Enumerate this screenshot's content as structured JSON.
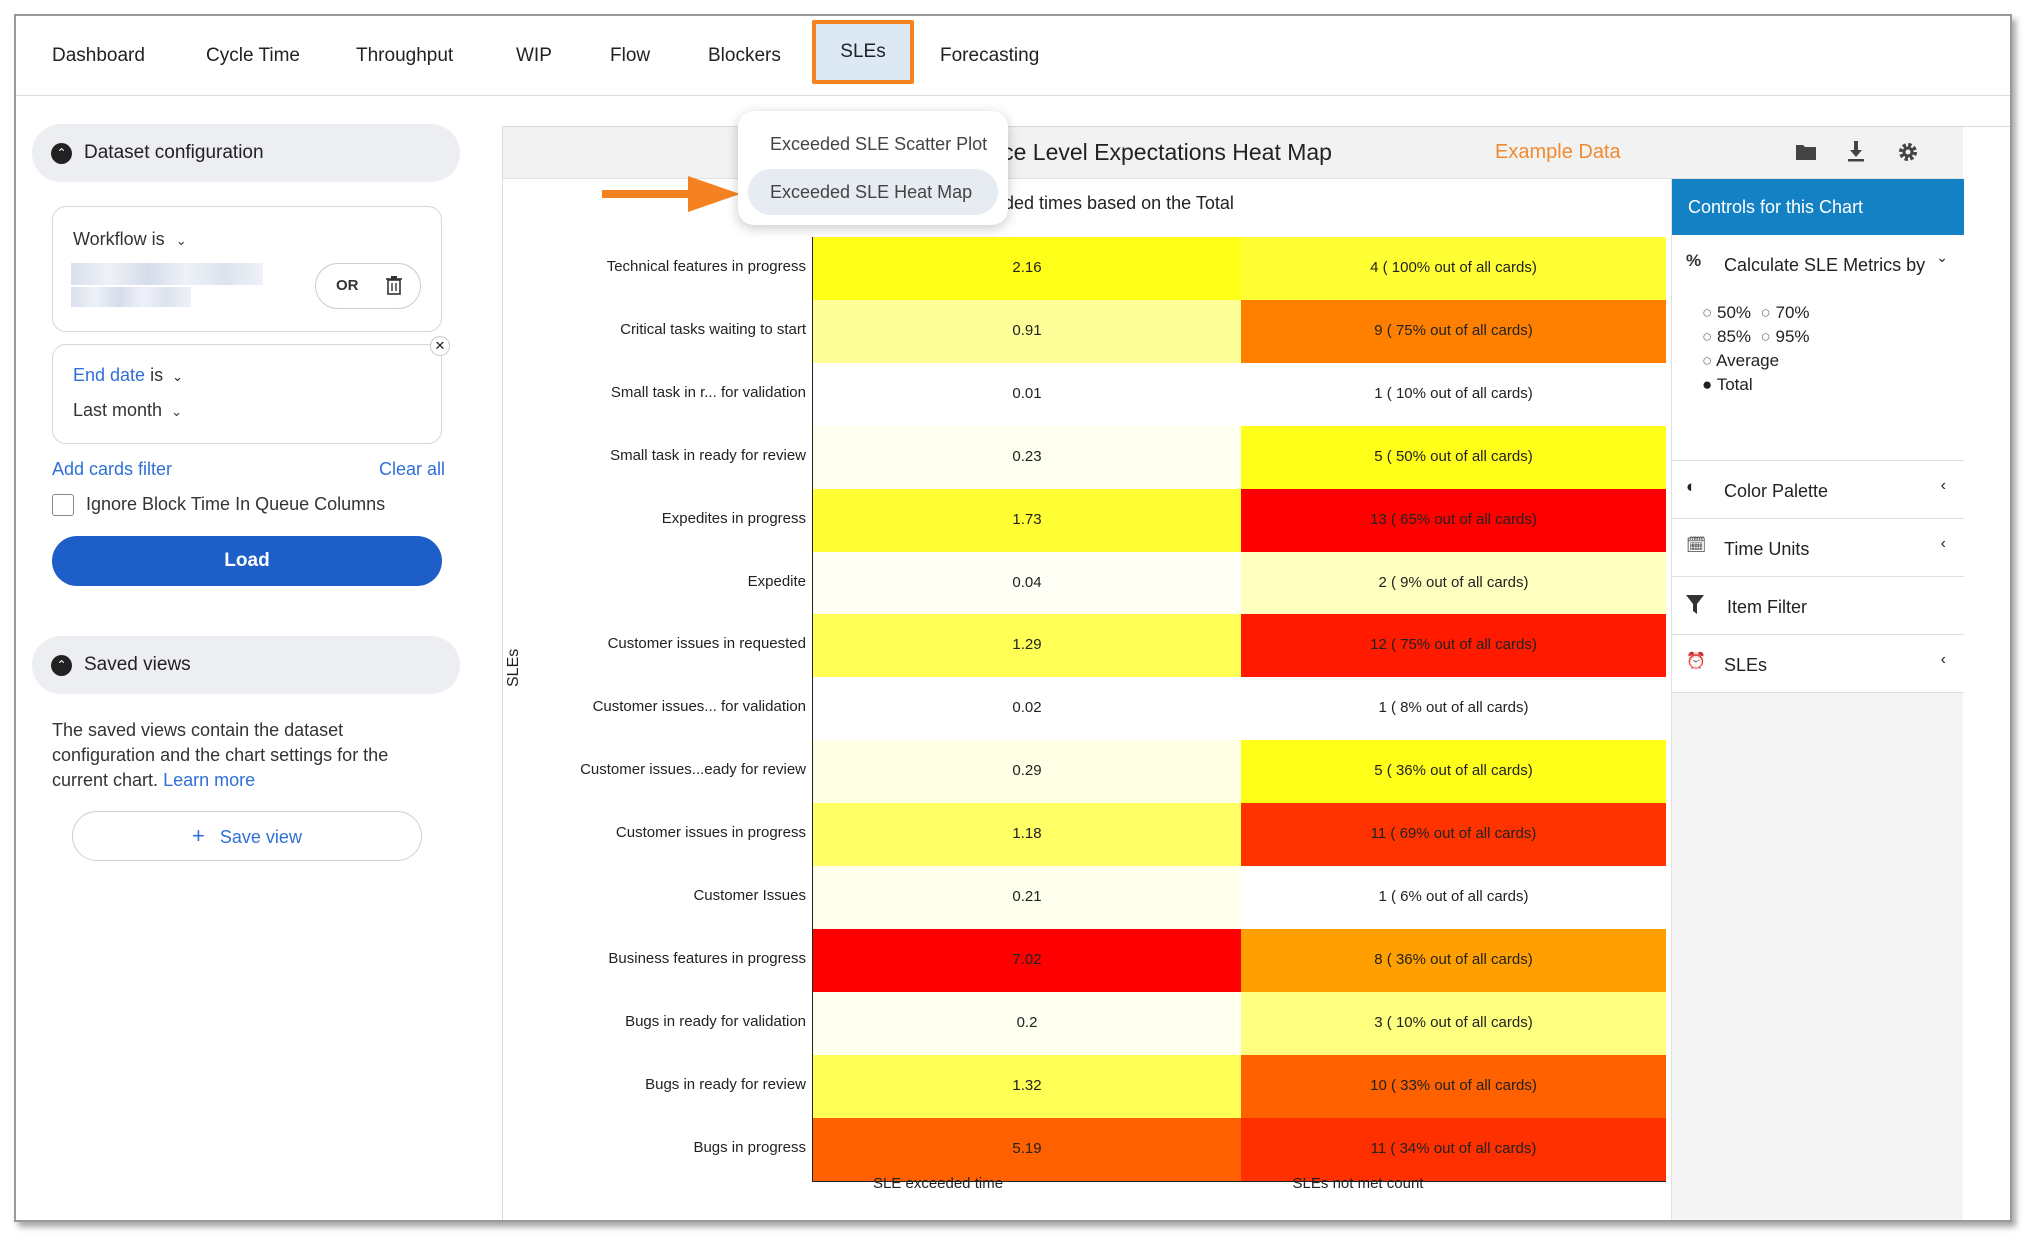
{
  "nav": {
    "tabs": [
      "Dashboard",
      "Cycle Time",
      "Throughput",
      "WIP",
      "Flow",
      "Blockers",
      "SLEs",
      "Forecasting"
    ],
    "active": "SLEs"
  },
  "dropdown": {
    "items": [
      "Exceeded SLE Scatter Plot",
      "Exceeded SLE Heat Map"
    ]
  },
  "dataset": {
    "title": "Dataset configuration",
    "workflow_label": "Workflow is",
    "or_label": "OR",
    "end_date_label": "End date",
    "end_date_is": "is",
    "end_date_value": "Last month",
    "add_filter": "Add cards filter",
    "clear_all": "Clear all",
    "ignore_block": "Ignore Block Time In Queue Columns",
    "load": "Load"
  },
  "saved": {
    "title": "Saved views",
    "desc": "The saved views contain the dataset configuration and the chart settings for the current chart.",
    "learn_more": "Learn more",
    "save_view": "Save view"
  },
  "chart_header": {
    "title": "ice Level Expectations Heat Map",
    "example": "Example Data",
    "subtitle": "ceeded times based on the Total"
  },
  "controls": {
    "title": "Controls for this Chart",
    "calc_label": "Calculate SLE Metrics by",
    "options": [
      "50%",
      "70%",
      "85%",
      "95%",
      "Average",
      "Total"
    ],
    "selected": "Total",
    "color_palette": "Color Palette",
    "time_units": "Time Units",
    "item_filter": "Item Filter",
    "sles": "SLEs"
  },
  "chart_data": {
    "type": "heatmap",
    "ylabel": "SLEs",
    "columns": [
      "SLE exceeded time",
      "SLEs not met count"
    ],
    "rows": [
      {
        "label": "Technical features in progress",
        "time": "2.16",
        "count": "4 ( 100% out of all cards)",
        "c1": "#ffff1a",
        "c2": "#ffff33"
      },
      {
        "label": "Critical tasks waiting to start",
        "time": "0.91",
        "count": "9 ( 75% out of all cards)",
        "c1": "#ffff99",
        "c2": "#ff8000"
      },
      {
        "label": "Small task in r... for validation",
        "time": "0.01",
        "count": "1 ( 10% out of all cards)",
        "c1": "#ffffff",
        "c2": "#ffffff"
      },
      {
        "label": "Small task in ready for review",
        "time": "0.23",
        "count": "5 ( 50% out of all cards)",
        "c1": "#fffff0",
        "c2": "#ffff1a"
      },
      {
        "label": "Expedites in progress",
        "time": "1.73",
        "count": "13 ( 65% out of all cards)",
        "c1": "#ffff33",
        "c2": "#ff0000"
      },
      {
        "label": "Expedite",
        "time": "0.04",
        "count": "2 ( 9% out of all cards)",
        "c1": "#fffff5",
        "c2": "#ffffc0"
      },
      {
        "label": "Customer issues in requested",
        "time": "1.29",
        "count": "12 ( 75% out of all cards)",
        "c1": "#ffff55",
        "c2": "#ff1a00"
      },
      {
        "label": "Customer issues... for validation",
        "time": "0.02",
        "count": "1 ( 8% out of all cards)",
        "c1": "#ffffff",
        "c2": "#ffffff"
      },
      {
        "label": "Customer issues...eady for review",
        "time": "0.29",
        "count": "5 ( 36% out of all cards)",
        "c1": "#ffffe6",
        "c2": "#ffff1a"
      },
      {
        "label": "Customer issues in progress",
        "time": "1.18",
        "count": "11 ( 69% out of all cards)",
        "c1": "#ffff66",
        "c2": "#ff3300"
      },
      {
        "label": "Customer Issues",
        "time": "0.21",
        "count": "1 ( 6% out of all cards)",
        "c1": "#ffffee",
        "c2": "#ffffff"
      },
      {
        "label": "Business features in progress",
        "time": "7.02",
        "count": "8 ( 36% out of all cards)",
        "c1": "#ff0000",
        "c2": "#ffa000"
      },
      {
        "label": "Bugs in ready for validation",
        "time": "0.2",
        "count": "3 ( 10% out of all cards)",
        "c1": "#fffff0",
        "c2": "#ffff80"
      },
      {
        "label": "Bugs in ready for review",
        "time": "1.32",
        "count": "10 ( 33% out of all cards)",
        "c1": "#ffff55",
        "c2": "#ff6000"
      },
      {
        "label": "Bugs in progress",
        "time": "5.19",
        "count": "11 ( 34% out of all cards)",
        "c1": "#ff6000",
        "c2": "#ff3000"
      }
    ]
  }
}
